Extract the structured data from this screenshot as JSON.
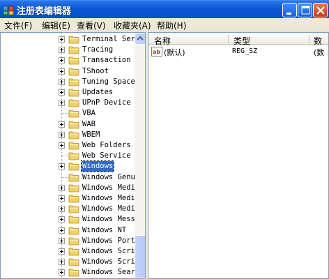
{
  "window": {
    "title": "注册表编辑器"
  },
  "menu": {
    "items": [
      {
        "label": "文件(F)"
      },
      {
        "label": "编辑(E)"
      },
      {
        "label": "查看(V)"
      },
      {
        "label": "收藏夹(A)"
      },
      {
        "label": "帮助(H)"
      }
    ]
  },
  "tree": {
    "items": [
      {
        "label": "Terminal Serv",
        "expandable": true
      },
      {
        "label": "Tracing",
        "expandable": true
      },
      {
        "label": "Transaction S",
        "expandable": true
      },
      {
        "label": "TShoot",
        "expandable": true
      },
      {
        "label": "Tuning Spaces",
        "expandable": true
      },
      {
        "label": "Updates",
        "expandable": true
      },
      {
        "label": "UPnP Device H",
        "expandable": true
      },
      {
        "label": "VBA",
        "expandable": false
      },
      {
        "label": "WAB",
        "expandable": true
      },
      {
        "label": "WBEM",
        "expandable": true
      },
      {
        "label": "Web Folders",
        "expandable": true
      },
      {
        "label": "Web Service P",
        "expandable": false
      },
      {
        "label": "Windows",
        "expandable": true,
        "selected": true
      },
      {
        "label": "Windows Genui",
        "expandable": false
      },
      {
        "label": "Windows Media",
        "expandable": true
      },
      {
        "label": "Windows Media",
        "expandable": true
      },
      {
        "label": "Windows Media",
        "expandable": true
      },
      {
        "label": "Windows Messe",
        "expandable": true
      },
      {
        "label": "Windows NT",
        "expandable": true
      },
      {
        "label": "Windows Porta",
        "expandable": true
      },
      {
        "label": "Windows Scrip",
        "expandable": true
      },
      {
        "label": "Windows Scrip",
        "expandable": true
      },
      {
        "label": "Windows Searc",
        "expandable": true
      }
    ]
  },
  "list": {
    "columns": [
      {
        "label": "名称"
      },
      {
        "label": "类型"
      },
      {
        "label": "数"
      }
    ],
    "rows": [
      {
        "name": "(默认)",
        "type": "REG_SZ",
        "data": "(数"
      }
    ]
  },
  "colors": {
    "titlebar": "#0A58D6",
    "selection": "#316AC5",
    "folder": "#F2D06B"
  }
}
